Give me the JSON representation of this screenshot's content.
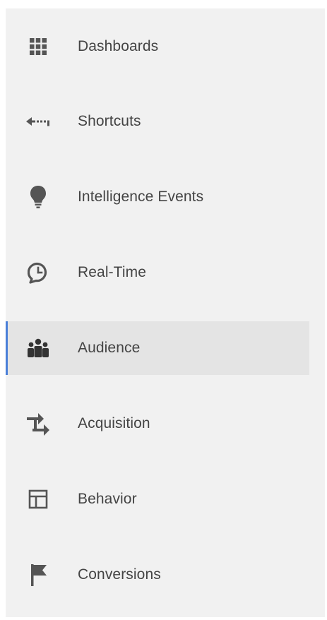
{
  "nav": {
    "items": [
      {
        "label": "Dashboards",
        "icon": "grid-icon"
      },
      {
        "label": "Shortcuts",
        "icon": "arrow-left-dotted-icon"
      },
      {
        "label": "Intelligence Events",
        "icon": "lightbulb-icon"
      },
      {
        "label": "Real-Time",
        "icon": "clock-icon"
      },
      {
        "label": "Audience",
        "icon": "people-icon",
        "active": true
      },
      {
        "label": "Acquisition",
        "icon": "swap-arrows-icon"
      },
      {
        "label": "Behavior",
        "icon": "layout-icon"
      },
      {
        "label": "Conversions",
        "icon": "flag-icon"
      }
    ]
  },
  "colors": {
    "sidebar_background": "#f1f1f1",
    "active_background": "#e4e4e4",
    "active_indicator": "#4a7fd8",
    "label_text": "#444444",
    "icon": "#555555"
  }
}
